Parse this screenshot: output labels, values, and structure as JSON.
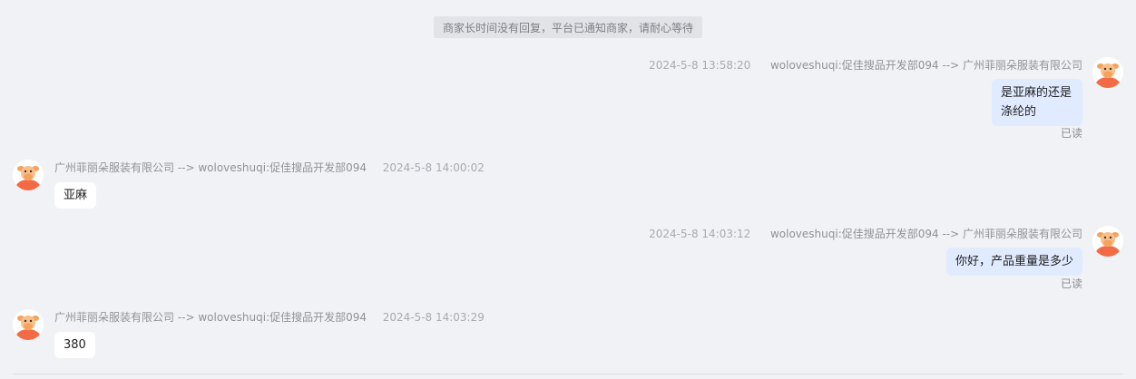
{
  "notice": "商家长时间没有回复，平台已通知商家，请耐心等待",
  "messages": [
    {
      "time": "2024-5-8 13:58:20",
      "route": "woloveshuqi:促佳搜品开发部094 --> 广州菲丽朵服装有限公司",
      "text_line1": "是亚麻的还是",
      "text_line2": "涤纶的",
      "status": "已读"
    },
    {
      "route": "广州菲丽朵服装有限公司 --> woloveshuqi:促佳搜品开发部094",
      "time": "2024-5-8 14:00:02",
      "text": "亚麻"
    },
    {
      "time": "2024-5-8 14:03:12",
      "route": "woloveshuqi:促佳搜品开发部094 --> 广州菲丽朵服装有限公司",
      "text": "你好，产品重量是多少",
      "status": "已读"
    },
    {
      "route": "广州菲丽朵服装有限公司 --> woloveshuqi:促佳搜品开发部094",
      "time": "2024-5-8 14:03:29",
      "text": "380"
    }
  ],
  "colors": {
    "background": "#f0f2f5",
    "my_bubble": "#e1ebff",
    "their_bubble": "#ffffff",
    "avatar_face": "#f5a25d",
    "avatar_body": "#f26b45"
  }
}
